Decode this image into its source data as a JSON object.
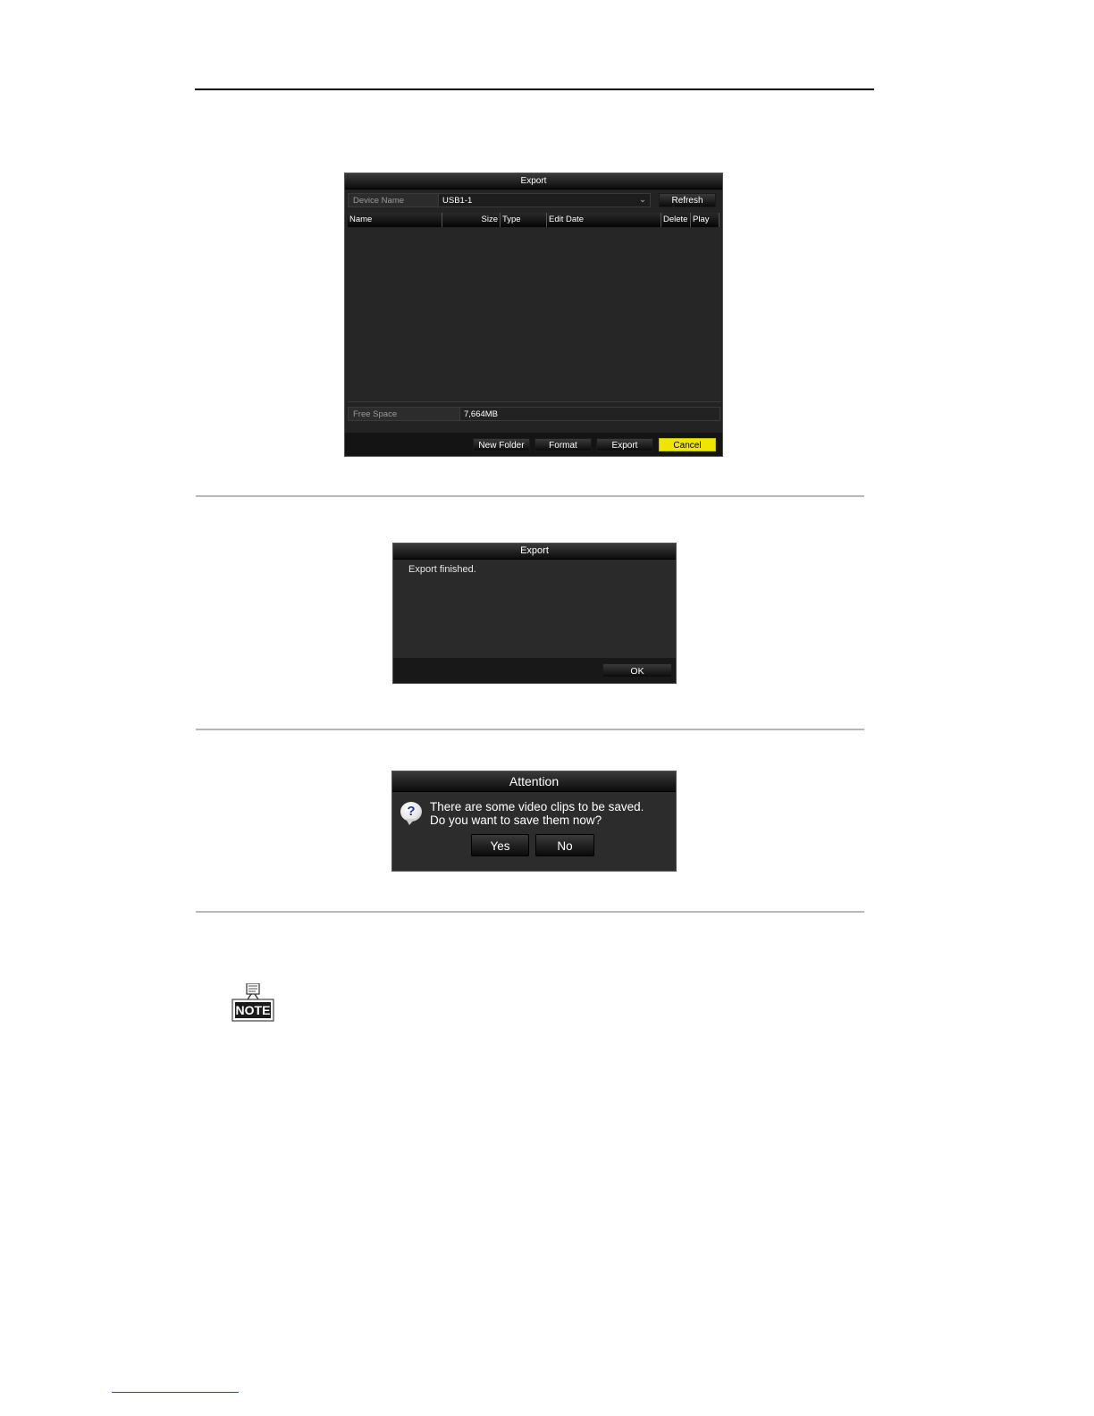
{
  "export_dialog": {
    "title": "Export",
    "device_name_label": "Device Name",
    "device_name_value": "USB1-1",
    "dropdown_glyph": "⌄",
    "refresh_label": "Refresh",
    "columns": [
      "Name",
      "Size",
      "Type",
      "Edit Date",
      "Delete",
      "Play"
    ],
    "free_space_label": "Free Space",
    "free_space_value": "7,664MB",
    "buttons": {
      "new_folder": "New Folder",
      "format": "Format",
      "export": "Export",
      "cancel": "Cancel"
    },
    "cancel_color": "#f0e500"
  },
  "finished_dialog": {
    "title": "Export",
    "message": "Export finished.",
    "ok_label": "OK"
  },
  "attention_dialog": {
    "title": "Attention",
    "icon": "question-icon",
    "icon_glyph": "?",
    "line1": "There are some video clips to be saved.",
    "line2": "Do you want to save them now?",
    "yes_label": "Yes",
    "no_label": "No"
  },
  "note": {
    "icon": "note-icon",
    "label": "NOTE"
  }
}
